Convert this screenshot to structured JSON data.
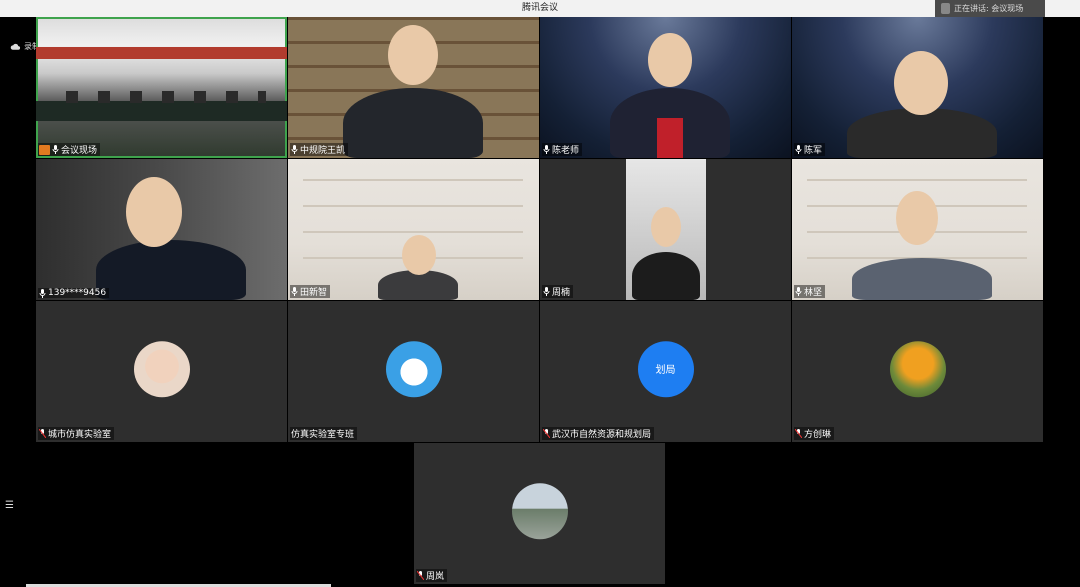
{
  "app": {
    "title": "腾讯会议",
    "speaking_label": "正在讲话: 会议现场",
    "recording_label": "录制中"
  },
  "colors": {
    "active_speaker_border": "#3fa34d",
    "host_badge": "#e27a20",
    "avatar_blue": "#1e7ef2"
  },
  "participants": [
    {
      "name": "会议现场",
      "host": true,
      "active": true
    },
    {
      "name": "中规院王凯"
    },
    {
      "name": "陈老师"
    },
    {
      "name": "陈军"
    },
    {
      "name": "139****9456"
    },
    {
      "name": "田新智"
    },
    {
      "name": "周楠"
    },
    {
      "name": "林坚"
    },
    {
      "name": "城市仿真实验室",
      "avatar": "child-photo"
    },
    {
      "name": "仿真实验室专班",
      "avatar": "robot-character"
    },
    {
      "name": "武汉市自然资源和规划局",
      "avatar_text": "划局"
    },
    {
      "name": "方创琳",
      "avatar": "autumn-tree"
    },
    {
      "name": "周岚",
      "avatar": "campus-photo"
    }
  ]
}
